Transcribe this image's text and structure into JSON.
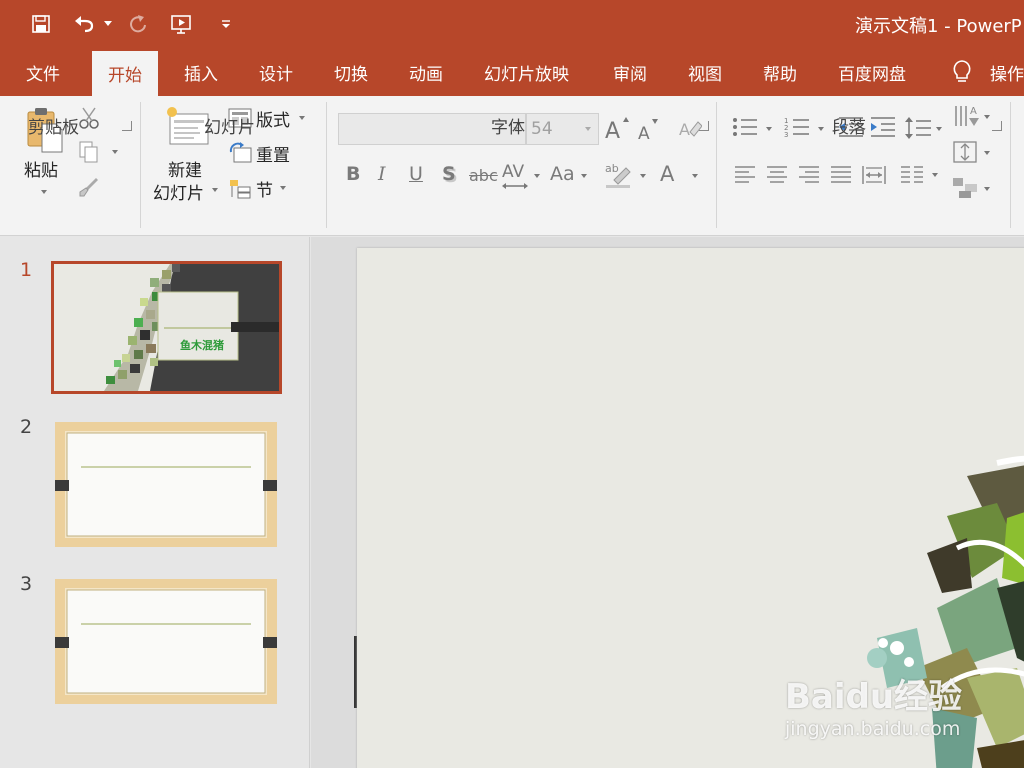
{
  "title": "演示文稿1 - PowerP",
  "tabs": [
    "文件",
    "开始",
    "插入",
    "设计",
    "切换",
    "动画",
    "幻灯片放映",
    "审阅",
    "视图",
    "帮助",
    "百度网盘",
    "操作"
  ],
  "active_tab": "开始",
  "ribbon": {
    "clipboard": {
      "paste": "粘贴",
      "label": "剪贴板"
    },
    "slides": {
      "new_slide_line1": "新建",
      "new_slide_line2": "幻灯片",
      "layout": "版式",
      "reset": "重置",
      "section": "节",
      "label": "幻灯片"
    },
    "font": {
      "name_value": "",
      "size_value": "54",
      "label": "字体",
      "bold": "B",
      "italic": "I",
      "underline": "U",
      "shadow": "S",
      "strike": "abc",
      "spacing": "AV",
      "case": "Aa",
      "color": "A"
    },
    "paragraph": {
      "label": "段落"
    }
  },
  "slides": [
    {
      "number": "1",
      "title_text": "鱼木混猪"
    },
    {
      "number": "2"
    },
    {
      "number": "3"
    }
  ],
  "watermark": {
    "brand": "Baidu经验",
    "url": "jingyan.baidu.com"
  },
  "colors": {
    "accent": "#b7472a",
    "ribbon": "#f3f3f3",
    "pane": "#e6e6e6"
  }
}
